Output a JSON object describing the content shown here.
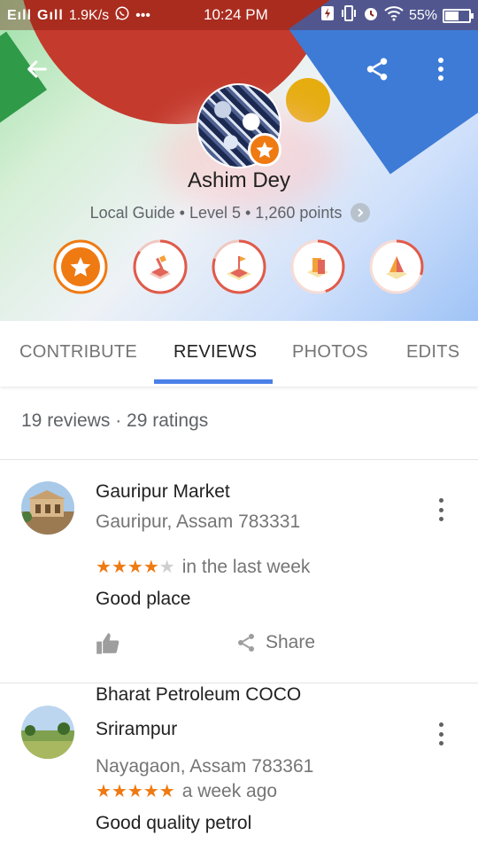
{
  "status_bar": {
    "carrier1": "E",
    "carrier2": "G",
    "speed": "1.9K/s",
    "time": "10:24 PM",
    "battery": "55%",
    "battery_level": 0.55
  },
  "icons": {
    "back": "arrow-left-icon",
    "share": "share-icon",
    "more": "more-vert-icon"
  },
  "profile": {
    "name": "Ashim Dey",
    "subtitle": "Local Guide • Level 5 • 1,260 points",
    "level_badge_color": "#ef7a12"
  },
  "badges": [
    {
      "name": "star-badge",
      "progress": 1.0
    },
    {
      "name": "reviews-badge",
      "progress": 0.85
    },
    {
      "name": "photos-badge",
      "progress": 0.8
    },
    {
      "name": "edits-badge",
      "progress": 0.45
    },
    {
      "name": "places-badge",
      "progress": 0.3
    }
  ],
  "tabs": [
    {
      "label": "CONTRIBUTE",
      "active": false
    },
    {
      "label": "REVIEWS",
      "active": true
    },
    {
      "label": "PHOTOS",
      "active": false
    },
    {
      "label": "EDITS",
      "active": false
    }
  ],
  "summary": "19 reviews · 29 ratings",
  "reviews": [
    {
      "title": "Gauripur Market",
      "address": "Gauripur, Assam 783331",
      "rating": 4,
      "when": "in the last week",
      "text": "Good place",
      "share_label": "Share"
    },
    {
      "title_line1": "Bharat Petroleum COCO",
      "title_line2": "Srirampur",
      "address": "Nayagaon, Assam 783361",
      "rating": 5,
      "when": "a week ago",
      "text": "Good quality petrol"
    }
  ],
  "colors": {
    "accent": "#4a80e8",
    "star": "#ef7a12"
  }
}
